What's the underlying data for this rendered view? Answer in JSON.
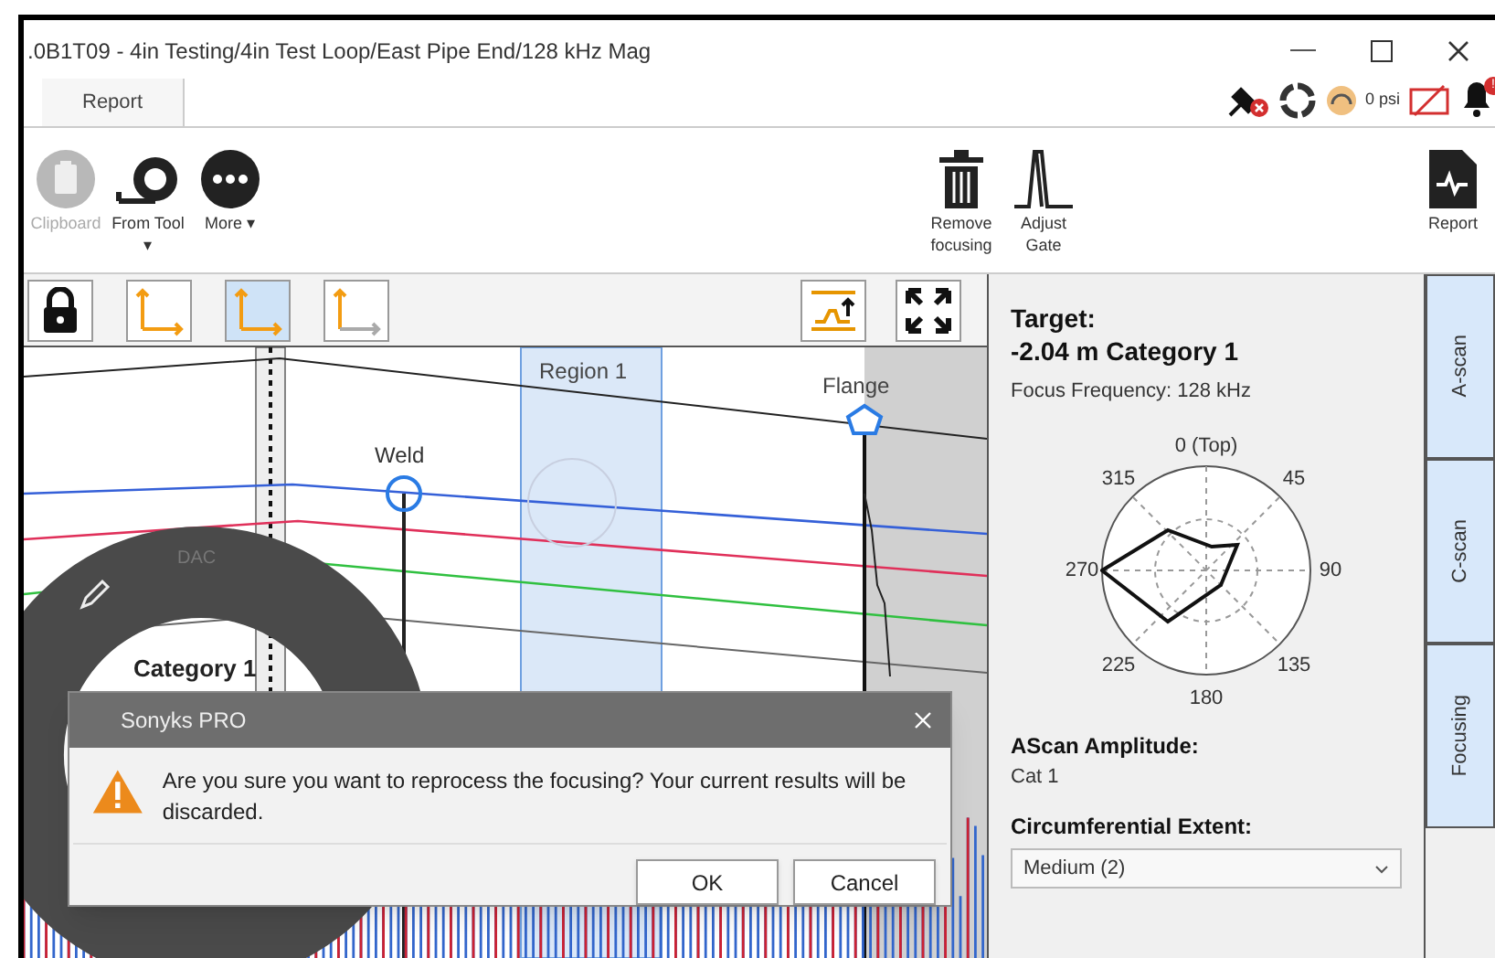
{
  "window": {
    "title": ".0B1T09 - 4in Testing/4in Test Loop/East Pipe End/128 kHz Mag"
  },
  "ribbon_tabs": [
    {
      "label": "Report"
    }
  ],
  "status": {
    "pressure": "0 psi",
    "alert_badge": "!"
  },
  "toolbar": [
    {
      "kind": "clipboard",
      "label": "Clipboard",
      "disabled": true
    },
    {
      "kind": "tape",
      "label": "From Tool ▾",
      "disabled": false
    },
    {
      "kind": "more",
      "label": "More ▾",
      "disabled": false
    },
    {
      "kind": "trash",
      "label": "Remove focusing",
      "disabled": false
    },
    {
      "kind": "gate",
      "label": "Adjust Gate",
      "disabled": false
    },
    {
      "kind": "report",
      "label": "Report",
      "disabled": false
    }
  ],
  "plot_tools": [
    {
      "kind": "lock",
      "selected": false
    },
    {
      "kind": "axes",
      "selected": false
    },
    {
      "kind": "axes",
      "selected": true
    },
    {
      "kind": "axes-y",
      "selected": false
    }
  ],
  "plot": {
    "region": "Region 1",
    "weld": "Weld",
    "flange": "Flange",
    "ring_mode": "DAC",
    "ring_category": "Category 1"
  },
  "dialog": {
    "title": "Sonyks PRO",
    "message": "Are you sure you want to reprocess the focusing? Your current results will be discarded.",
    "buttons": [
      "OK",
      "Cancel"
    ]
  },
  "panel": {
    "target_label": "Target:",
    "target_value": "-2.04 m Category 1",
    "focus_frequency": "Focus Frequency: 128 kHz",
    "polar_labels": [
      "0 (Top)",
      "45",
      "90",
      "135",
      "180",
      "225",
      "270",
      "315"
    ],
    "amplitude_label": "AScan Amplitude:",
    "amplitude_value": "Cat 1",
    "extent_label": "Circumferential Extent:",
    "extent_value": "Medium (2)"
  },
  "side_tabs": [
    {
      "label": "A-scan"
    },
    {
      "label": "C-scan"
    },
    {
      "label": "Focusing"
    }
  ]
}
